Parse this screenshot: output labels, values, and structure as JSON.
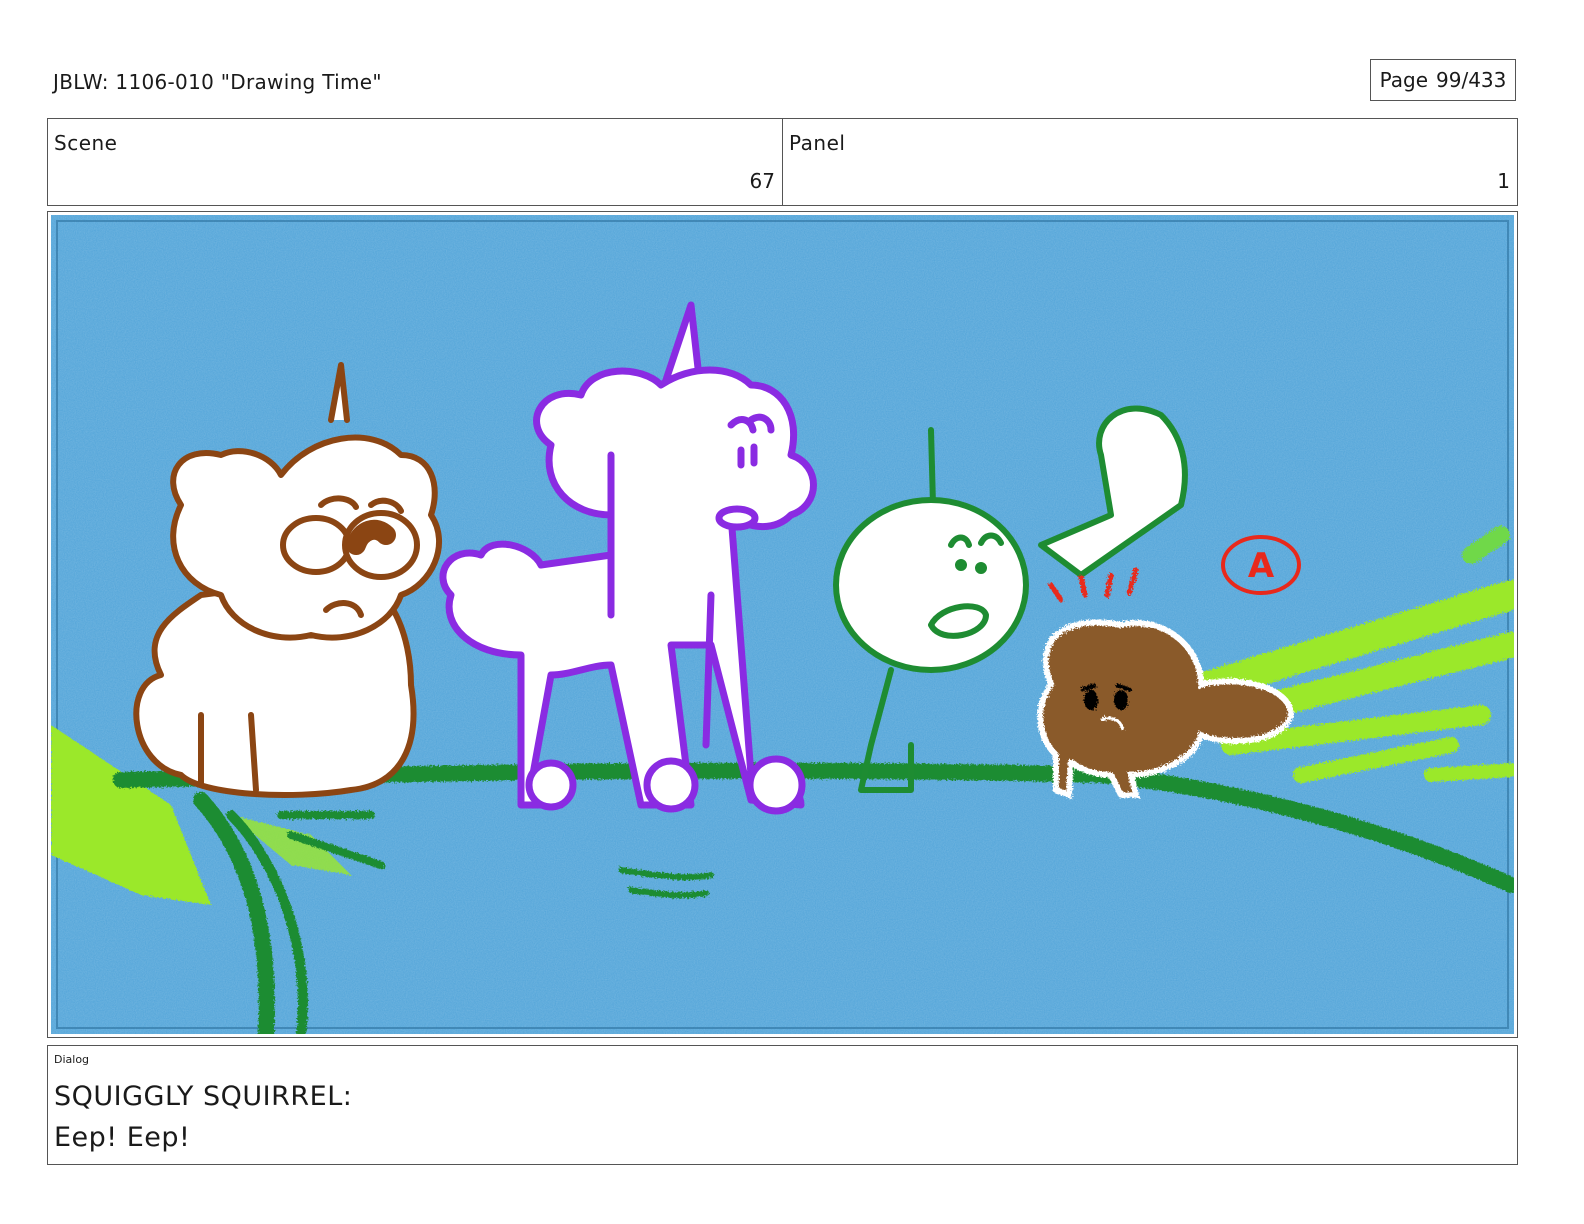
{
  "header": {
    "title": "JBLW: 1106-010 \"Drawing Time\"",
    "page_label": "Page",
    "page_number": "99/433"
  },
  "scene": {
    "label": "Scene",
    "value": "67"
  },
  "panel": {
    "label": "Panel",
    "value": "1"
  },
  "artwork": {
    "mark_letter": "A",
    "colors": {
      "paper": "#4fa3d8",
      "bear_outline": "#8b4513",
      "unicorn_outline": "#8a2be2",
      "stickman_outline": "#1e8c32",
      "squirrel_fill": "#8a5a2b",
      "grass_light": "#9be82a",
      "mark_red": "#e8291c"
    }
  },
  "dialog": {
    "label": "Dialog",
    "speaker": "SQUIGGLY SQUIRREL:",
    "line": "Eep! Eep!"
  }
}
